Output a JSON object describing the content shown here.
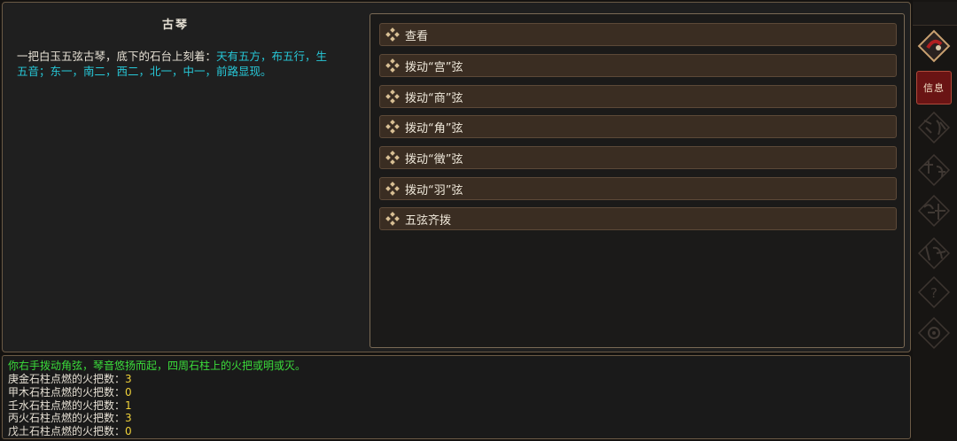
{
  "dialog": {
    "title": "古琴",
    "description_plain": "一把白玉五弦古琴，底下的石台上刻着：",
    "description_highlight": "天有五方，布五行，生五音；东一，南二，西二，北一，中一，前路显现。"
  },
  "actions": [
    {
      "label": "查看"
    },
    {
      "label": "拨动“宫”弦"
    },
    {
      "label": "拨动“商”弦"
    },
    {
      "label": "拨动“角”弦"
    },
    {
      "label": "拨动“徵”弦"
    },
    {
      "label": "拨动“羽”弦"
    },
    {
      "label": "五弦齐拨"
    }
  ],
  "log": {
    "message": "你右手拨动角弦，琴音悠扬而起，四周石柱上的火把或明或灭。",
    "counts": [
      {
        "label": "庚金石柱点燃的火把数：",
        "value": "3"
      },
      {
        "label": "甲木石柱点燃的火把数：",
        "value": "0"
      },
      {
        "label": "壬水石柱点燃的火把数：",
        "value": "1"
      },
      {
        "label": "丙火石柱点燃的火把数：",
        "value": "3"
      },
      {
        "label": "戊土石柱点燃的火把数：",
        "value": "0"
      }
    ]
  },
  "sidebar": {
    "info_label": "信息",
    "icons": [
      "back-diamond-icon",
      "inventory-icon",
      "skills-icon",
      "martial-arts-icon",
      "sect-icon",
      "help-icon",
      "settings-icon"
    ]
  },
  "colors": {
    "highlight": "#27c8d8",
    "log_message": "#3bdc3b",
    "log_value": "#f0d23a",
    "button_bg": "#3a2d22",
    "info_bg": "#6a1414"
  }
}
